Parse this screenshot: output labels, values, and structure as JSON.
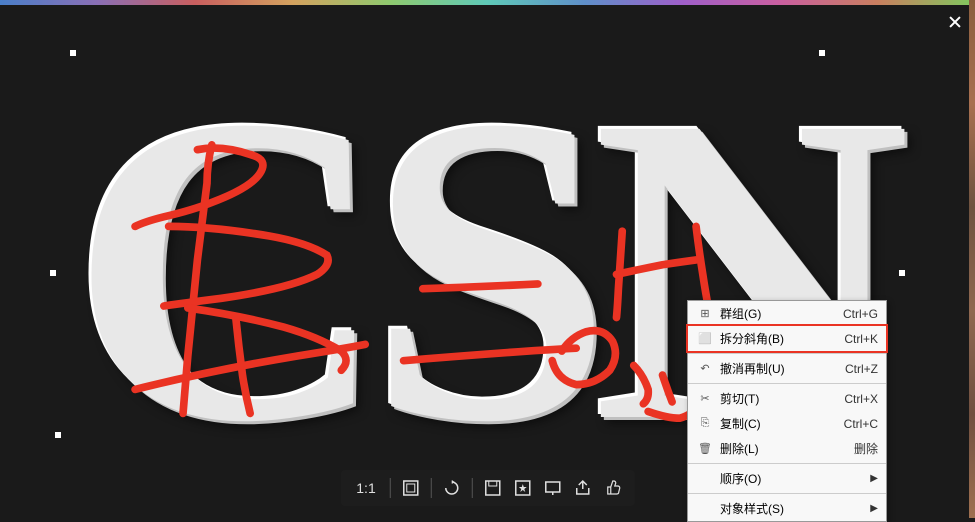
{
  "toolbar": {
    "zoom_label": "1:1"
  },
  "letters": "CSN",
  "context_menu": {
    "items": [
      {
        "icon": "group",
        "label": "群组(G)",
        "shortcut": "Ctrl+G"
      },
      {
        "icon": "break",
        "label": "拆分斜角(B)",
        "shortcut": "Ctrl+K",
        "highlighted": true
      },
      {
        "icon": "undo-copy",
        "label": "撤消再制(U)",
        "shortcut": "Ctrl+Z"
      },
      {
        "icon": "cut",
        "label": "剪切(T)",
        "shortcut": "Ctrl+X"
      },
      {
        "icon": "copy",
        "label": "复制(C)",
        "shortcut": "Ctrl+C"
      },
      {
        "icon": "delete",
        "label": "删除(L)",
        "shortcut": "删除"
      },
      {
        "icon": "",
        "label": "顺序(O)",
        "submenu": true
      },
      {
        "icon": "",
        "label": "对象样式(S)",
        "submenu": true
      }
    ]
  }
}
